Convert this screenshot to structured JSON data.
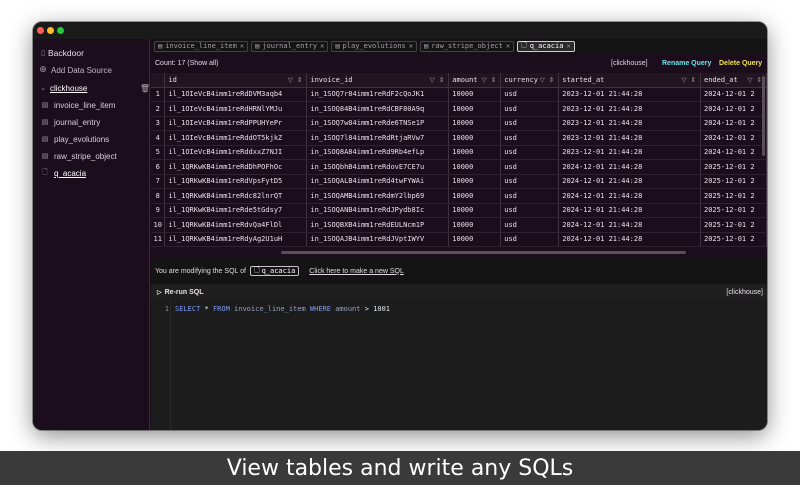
{
  "app": {
    "title": "Backdoor",
    "add_source": "Add Data Source"
  },
  "sidebar": {
    "database": "clickhouse",
    "tables": [
      "invoice_line_item",
      "journal_entry",
      "play_evolutions",
      "raw_stripe_object"
    ],
    "query": "q_acacia"
  },
  "tabs": [
    "invoice_line_item",
    "journal_entry",
    "play_evolutions",
    "raw_stripe_object",
    "q_acacia"
  ],
  "toolbar": {
    "count": "Count: 17 (Show all)",
    "connection": "[clickhouse]",
    "rename": "Rename Query",
    "delete": "Delete Query"
  },
  "grid": {
    "columns": [
      "id",
      "invoice_id",
      "amount",
      "currency",
      "started_at",
      "ended_at"
    ],
    "rows": [
      [
        "1",
        "il_1OIeVcB4imm1reRdDVM3aqb4",
        "in_1SOQ7r84imm1reRdF2cQoJK1",
        "10000",
        "usd",
        "2023-12-01 21:44:28",
        "2024-12-01 2"
      ],
      [
        "2",
        "il_1OIeVcB4imm1reRdHRNlYMJu",
        "in_1SOQ84B4imm1reRdCBF80A9q",
        "10000",
        "usd",
        "2023-12-01 21:44:28",
        "2024-12-01 2"
      ],
      [
        "3",
        "il_1OIeVcB4imm1reRdPPUHYePr",
        "in_1SOQ7w84imm1reRde6TNSe1P",
        "10000",
        "usd",
        "2023-12-01 21:44:28",
        "2024-12-01 2"
      ],
      [
        "4",
        "il_1OIeVcB4imm1reRddOT5kjkZ",
        "in_1SOQ7l84imm1reRdRtjaRVw7",
        "10000",
        "usd",
        "2023-12-01 21:44:28",
        "2024-12-01 2"
      ],
      [
        "5",
        "il_1OIeVcB4imm1reRddxxZ7NJI",
        "in_1SOQ8A84imm1reRd9Rb4efLp",
        "10000",
        "usd",
        "2023-12-01 21:44:28",
        "2024-12-01 2"
      ],
      [
        "6",
        "il_1QRKwKB4imm1reRdDhPOFhOc",
        "in_1SOQbhB4imm1reRdovE7CE7u",
        "10000",
        "usd",
        "2024-12-01 21:44:28",
        "2025-12-01 2"
      ],
      [
        "7",
        "il_1QRKwKB4imm1reRdVpsFytD5",
        "in_1SOQALB4imm1reRd4twFYWAi",
        "10000",
        "usd",
        "2024-12-01 21:44:28",
        "2025-12-01 2"
      ],
      [
        "8",
        "il_1QRKwKB4imm1reRdc82lnrQT",
        "in_1SOQAMB4imm1reRdmY2lbp69",
        "10000",
        "usd",
        "2024-12-01 21:44:28",
        "2025-12-01 2"
      ],
      [
        "9",
        "il_1QRKwKB4imm1reRde5tGdsy7",
        "in_1SOQANB4imm1reRdJPydb8Ic",
        "10000",
        "usd",
        "2024-12-01 21:44:28",
        "2025-12-01 2"
      ],
      [
        "10",
        "il_1QRKwKB4imm1reRdvQa4FlDl",
        "in_1SOQBXB4imm1reRdEULNcm1P",
        "10000",
        "usd",
        "2024-12-01 21:44:28",
        "2025-12-01 2"
      ],
      [
        "11",
        "il_1QRKwKB4imm1reRdyAg2U1uH",
        "in_1SOQAJB4imm1reRdJVptIWYV",
        "10000",
        "usd",
        "2024-12-01 21:44:28",
        "2025-12-01 2"
      ]
    ]
  },
  "sql_panel": {
    "modifying_prefix": "You are modifying the SQL of",
    "query_name": "q_acacia",
    "new_sql_link": "Click here to make a new SQL",
    "rerun": "Re-run SQL",
    "connection": "[clickhouse]",
    "line_number": "1",
    "sql": {
      "select": "SELECT",
      "star": "*",
      "from": "FROM",
      "table": "invoice_line_item",
      "where": "WHERE",
      "column": "amount",
      "op": ">",
      "value": "1001"
    }
  },
  "caption": "View tables and write any SQLs"
}
